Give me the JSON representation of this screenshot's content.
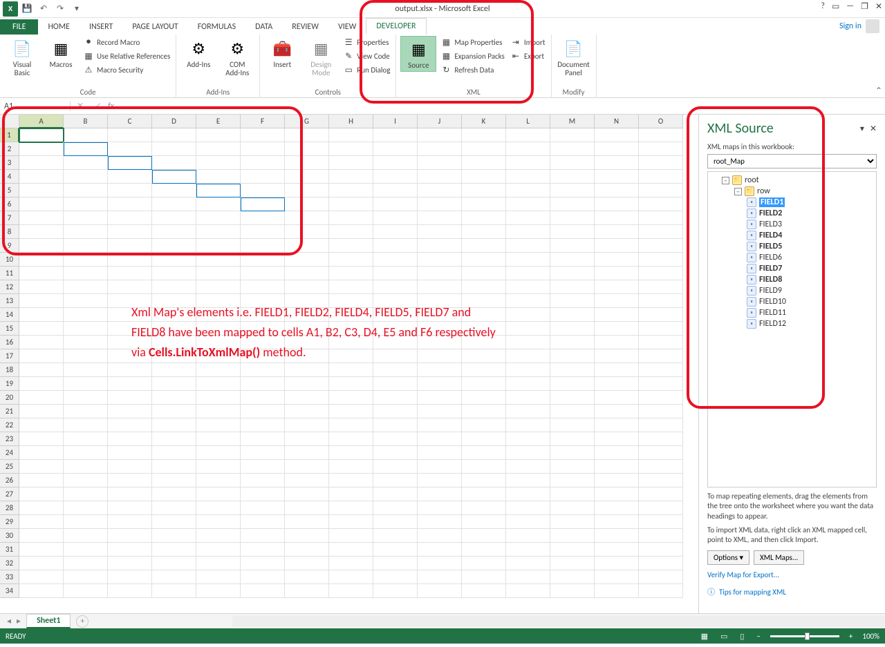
{
  "titlebar": {
    "title": "output.xlsx - Microsoft Excel"
  },
  "signin": "Sign in",
  "tabs": {
    "file": "FILE",
    "items": [
      "HOME",
      "INSERT",
      "PAGE LAYOUT",
      "FORMULAS",
      "DATA",
      "REVIEW",
      "VIEW",
      "DEVELOPER"
    ]
  },
  "ribbon": {
    "code": {
      "visual_basic": "Visual Basic",
      "macros": "Macros",
      "record": "Record Macro",
      "relrefs": "Use Relative References",
      "security": "Macro Security",
      "label": "Code"
    },
    "addins": {
      "addins": "Add-Ins",
      "com": "COM Add-Ins",
      "label": "Add-Ins"
    },
    "controls": {
      "insert": "Insert",
      "design": "Design Mode",
      "properties": "Properties",
      "view_code": "View Code",
      "run_dialog": "Run Dialog",
      "label": "Controls"
    },
    "xml": {
      "source": "Source",
      "map_props": "Map Properties",
      "expansion": "Expansion Packs",
      "refresh": "Refresh Data",
      "import": "Import",
      "export": "Export",
      "label": "XML"
    },
    "modify": {
      "panel": "Document Panel",
      "label": "Modify"
    }
  },
  "namebox": "A1",
  "columns": [
    "A",
    "B",
    "C",
    "D",
    "E",
    "F",
    "G",
    "H",
    "I",
    "J",
    "K",
    "L",
    "M",
    "N",
    "O"
  ],
  "rowcount": 34,
  "blueboxes": [
    [
      2,
      2
    ],
    [
      3,
      3
    ],
    [
      4,
      4
    ],
    [
      5,
      5
    ],
    [
      6,
      6
    ]
  ],
  "sheet": "Sheet1",
  "status": "READY",
  "zoom": "100%",
  "anno_line1": "Xml Map's elements i.e. FIELD1, FIELD2, FIELD4, FIELD5, FIELD7 and",
  "anno_line2": "FIELD8 have been mapped to cells A1, B2, C3, D4, E5 and F6 respectively",
  "anno_line3a": "via ",
  "anno_line3b": "Cells.LinkToXmlMap()",
  "anno_line3c": " method.",
  "xml_source": {
    "title": "XML Source",
    "maps_label": "XML maps in this workbook:",
    "map_name": "root_Map",
    "root": "root",
    "row": "row",
    "fields": [
      {
        "name": "FIELD1",
        "bold": true,
        "sel": true
      },
      {
        "name": "FIELD2",
        "bold": true
      },
      {
        "name": "FIELD3",
        "bold": false
      },
      {
        "name": "FIELD4",
        "bold": true
      },
      {
        "name": "FIELD5",
        "bold": true
      },
      {
        "name": "FIELD6",
        "bold": false
      },
      {
        "name": "FIELD7",
        "bold": true
      },
      {
        "name": "FIELD8",
        "bold": true
      },
      {
        "name": "FIELD9",
        "bold": false
      },
      {
        "name": "FIELD10",
        "bold": false
      },
      {
        "name": "FIELD11",
        "bold": false
      },
      {
        "name": "FIELD12",
        "bold": false
      }
    ],
    "hint1": "To map repeating elements, drag the elements from the tree onto the worksheet where you want the data headings to appear.",
    "hint2": "To import XML data, right click an XML mapped cell, point to XML, and then click Import.",
    "options": "Options",
    "xmlmaps": "XML Maps...",
    "verify": "Verify Map for Export...",
    "tips": "Tips for mapping XML"
  }
}
